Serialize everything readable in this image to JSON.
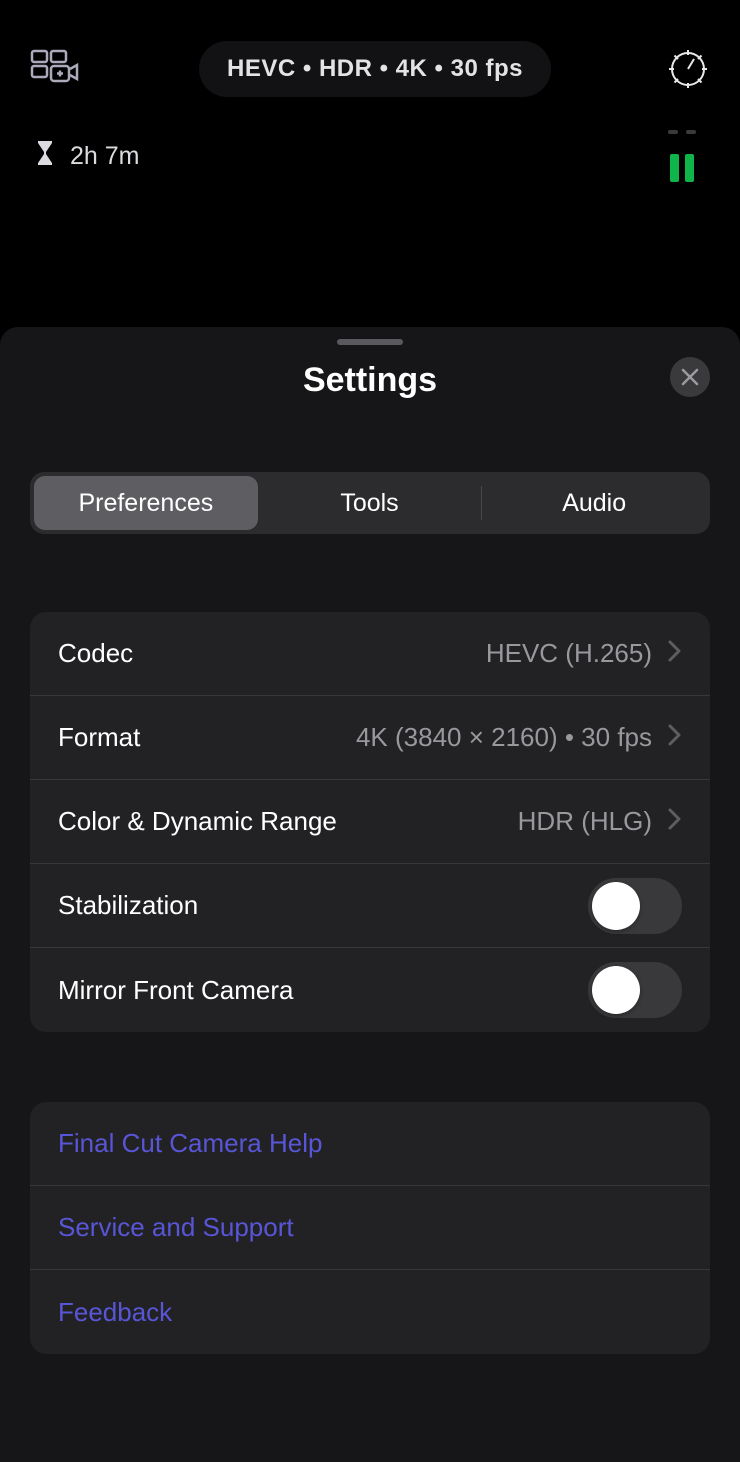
{
  "top": {
    "status_text": "HEVC  •  HDR  •  4K  •  30 fps",
    "time_remaining": "2h 7m"
  },
  "sheet": {
    "title": "Settings"
  },
  "tabs": {
    "preferences": "Preferences",
    "tools": "Tools",
    "audio": "Audio"
  },
  "prefs": {
    "codec_label": "Codec",
    "codec_value": "HEVC (H.265)",
    "format_label": "Format",
    "format_value": "4K (3840 × 2160) • 30 fps",
    "color_label": "Color & Dynamic Range",
    "color_value": "HDR (HLG)",
    "stabilization_label": "Stabilization",
    "mirror_label": "Mirror Front Camera"
  },
  "links": {
    "help": "Final Cut Camera Help",
    "support": "Service and Support",
    "feedback": "Feedback"
  }
}
